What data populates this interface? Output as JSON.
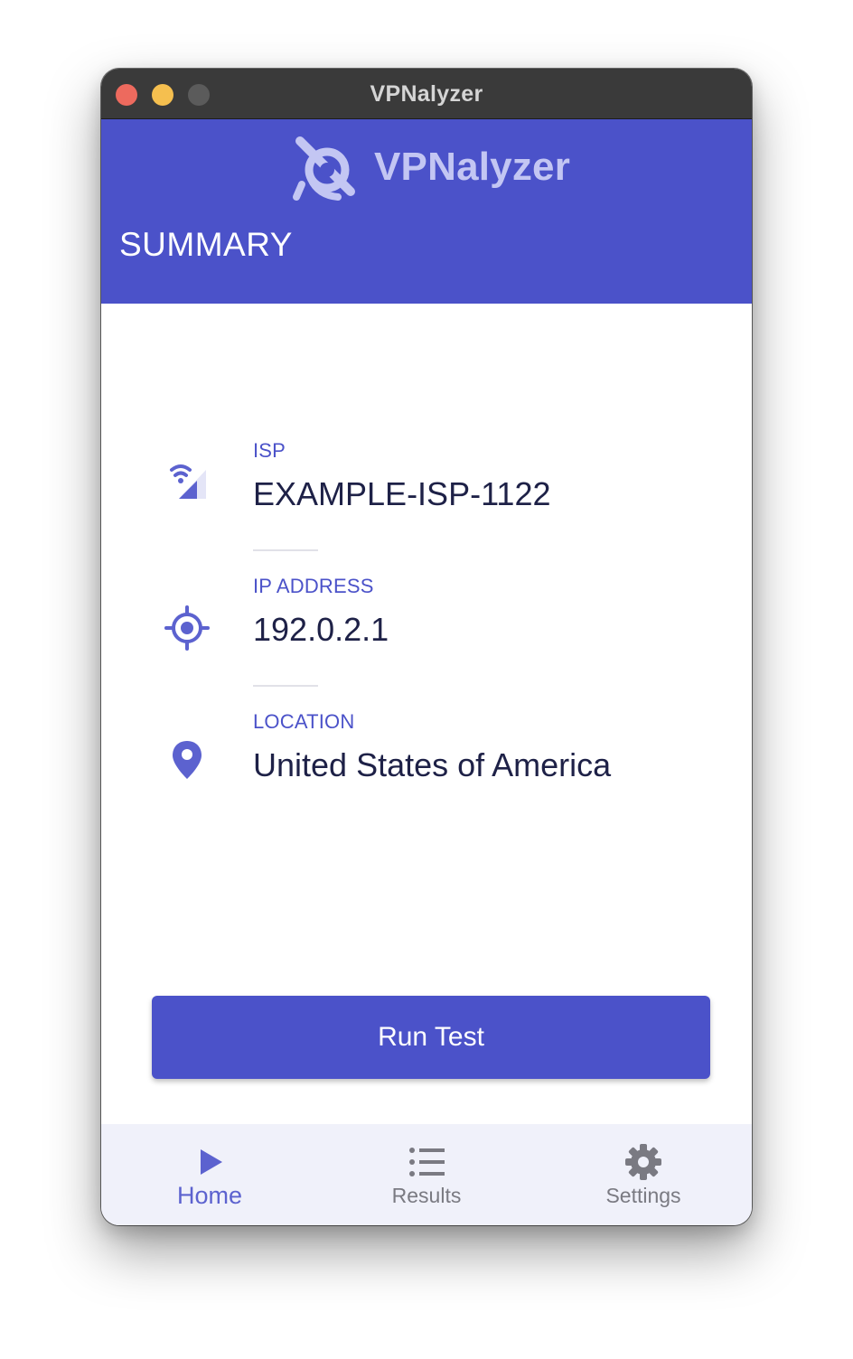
{
  "window": {
    "title": "VPNalyzer"
  },
  "header": {
    "brand_name": "VPNalyzer",
    "page_title": "SUMMARY"
  },
  "summary": {
    "items": [
      {
        "label": "ISP",
        "value": "EXAMPLE-ISP-1122",
        "icon": "signal-wifi-icon"
      },
      {
        "label": "IP ADDRESS",
        "value": "192.0.2.1",
        "icon": "crosshair-target-icon"
      },
      {
        "label": "LOCATION",
        "value": "United States of America",
        "icon": "location-pin-icon"
      }
    ]
  },
  "actions": {
    "run_test_label": "Run Test"
  },
  "nav": {
    "items": [
      {
        "label": "Home",
        "icon": "play-icon",
        "active": true
      },
      {
        "label": "Results",
        "icon": "list-icon",
        "active": false
      },
      {
        "label": "Settings",
        "icon": "gear-icon",
        "active": false
      }
    ]
  },
  "colors": {
    "accent": "#4b52c9",
    "brand_text": "#c3c6f3",
    "value_text": "#1e2147",
    "nav_background": "#f0f1fa",
    "nav_inactive": "#7a7a82",
    "titlebar": "#3a3a3a"
  }
}
